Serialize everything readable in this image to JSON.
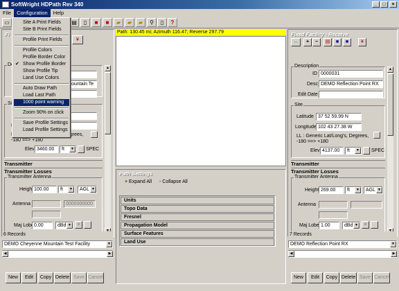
{
  "window": {
    "title": "SoftWright HDPath Rev 340"
  },
  "menubar": [
    "File",
    "Configuration",
    "Help"
  ],
  "menu": {
    "items": [
      {
        "label": "Site A Print Fields",
        "checked": false
      },
      {
        "label": "Site B Print Fields",
        "checked": false
      },
      {
        "sep": true
      },
      {
        "label": "Profile Print Fields",
        "checked": false
      },
      {
        "sep": true
      },
      {
        "label": "Profile Colors",
        "checked": false
      },
      {
        "label": "Profile Border Color",
        "checked": false
      },
      {
        "label": "Show Profile Border",
        "checked": true
      },
      {
        "label": "Show Profile Tip",
        "checked": false
      },
      {
        "label": "Land Use Colors",
        "checked": false
      },
      {
        "sep": true
      },
      {
        "label": "Auto Draw Path",
        "checked": false
      },
      {
        "label": "Load Last Path",
        "checked": false
      },
      {
        "label": "1000 point warning",
        "checked": false,
        "highlighted": true
      },
      {
        "sep": true
      },
      {
        "label": "Zoom 90% on click",
        "checked": false
      },
      {
        "sep": true
      },
      {
        "label": "Save Profile Settings",
        "checked": false
      },
      {
        "label": "Load Profile Settings",
        "checked": false
      }
    ]
  },
  "path_banner": "Path: 130.45 mi; Azimuth 116.47; Reverse 297.79",
  "left": {
    "header": "Fi",
    "description_group": "De",
    "desc_value": "ountain Te",
    "site_group": "Si",
    "ll_note": "LL : Generic Lat/Long's, Degrees,",
    "ll_range": "-180 ==> +180",
    "lat_prefix": "L",
    "elev_label": "Elev",
    "elev_value": "3460.00",
    "elev_unit": "ft",
    "spec": "SPEC",
    "transmitter": "Transmitter",
    "transmitter_losses": "Transmitter Losses",
    "antenna_group": "Transmitter Antenna",
    "height_label": "Height",
    "height_value": "100.00",
    "height_unit": "ft",
    "height_ref": "AGL",
    "antenna_label": "Antenna",
    "antenna_code": "0000000000",
    "majlobe_label": "Maj Lobe",
    "majlobe_value": "0.00",
    "majlobe_unit": "dBd",
    "records": "6 Records",
    "selected_record": "DEMO Cheyenne Mountain Test Facility",
    "buttons": [
      "New",
      "Edit",
      "Copy",
      "Delete",
      "Save",
      "Cancel"
    ]
  },
  "right": {
    "header": "Fixed Facility - Receive",
    "description_group": "Description",
    "id_label": "ID",
    "id_value": "0000031",
    "desc_label": "Desc",
    "desc_value": "DEMO Reflection Point RX",
    "editdate_label": "Edit Date",
    "site_group": "Site",
    "lat_label": "Latitude",
    "lat_value": "37 52 59.99 N",
    "lon_label": "Longitude",
    "lon_value": "102 43 27.38 W",
    "ll_note": "LL : Generic Lat/Long's, Degrees,",
    "ll_range": "-180 ==> +180",
    "elev_label": "Elev",
    "elev_value": "4137.00",
    "elev_unit": "ft",
    "spec": "SPEC",
    "transmitter": "Transmitter",
    "transmitter_losses": "Transmitter Losses",
    "antenna_group": "Transmitter Antenna",
    "height_label": "Height",
    "height_value": "269.00",
    "height_unit": "ft",
    "height_ref": "AGL",
    "antenna_label": "Antenna",
    "majlobe_label": "Maj Lobe",
    "majlobe_value": "1.00",
    "majlobe_unit": "dBd",
    "records": "7 Records",
    "selected_record": "DEMO Reflection Point RX",
    "buttons": [
      "New",
      "Edit",
      "Copy",
      "Delete",
      "Save",
      "Cancel"
    ]
  },
  "path_settings": {
    "title": "Path Settings",
    "expand": "+ Expand All",
    "collapse": "- Collapse All",
    "sections": [
      "Units",
      "Topo Data",
      "Fresnel",
      "Propagation Model",
      "Surface Features",
      "Land Use"
    ]
  }
}
